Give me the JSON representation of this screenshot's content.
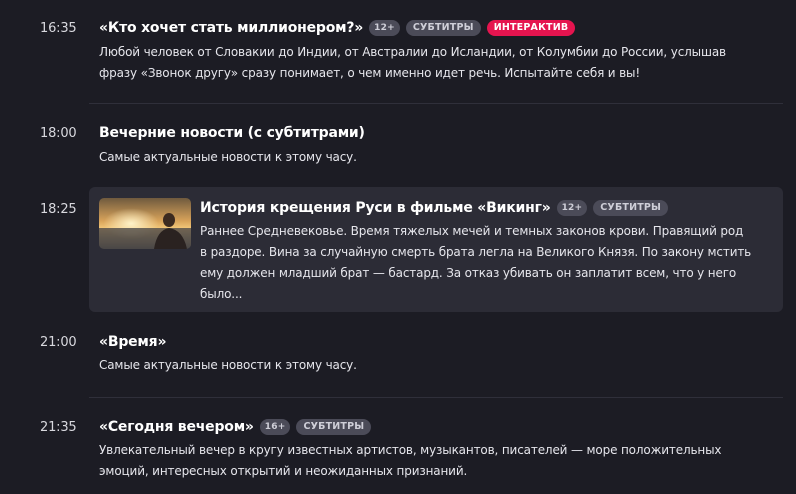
{
  "programs": [
    {
      "time": "16:35",
      "title": "«Кто хочет стать миллионером?»",
      "age": "12+",
      "badges": [
        "СУБТИТРЫ",
        "ИНТЕРАКТИВ"
      ],
      "description_lines": [
        "Любой человек от Словакии до Индии, от Австралии до Исландии, от Колумбии до России, услышав",
        "фразу «Звонок другу» сразу понимает, о чем именно идет речь. Испытайте себя и вы!"
      ]
    },
    {
      "time": "18:00",
      "title": "Вечерние новости (с субтитрами)",
      "description_lines": [
        "Самые актуальные новости к этому часу."
      ]
    },
    {
      "time": "18:25",
      "title": "История крещения Руси в фильме «Викинг»",
      "age": "12+",
      "badges": [
        "СУБТИТРЫ"
      ],
      "thumbnail": "sunset-warrior-still",
      "description_lines": [
        "Раннее Средневековье. Время тяжелых мечей и темных законов крови. Правящий род",
        "в раздоре. Вина за случайную смерть брата легла на Великого Князя. По закону мстить",
        "ему должен младший брат — бастард. За отказ убивать он заплатит всем, что у него",
        "было..."
      ]
    },
    {
      "time": "21:00",
      "title": "«Время»",
      "description_lines": [
        "Самые актуальные новости к этому часу."
      ]
    },
    {
      "time": "21:35",
      "title": "«Сегодня вечером»",
      "age": "16+",
      "badges": [
        "СУБТИТРЫ"
      ],
      "description_lines": [
        "Увлекательный вечер в кругу известных артистов, музыкантов, писателей — море положительных",
        "эмоций, интересных открытий и неожиданных признаний."
      ]
    }
  ],
  "colors": {
    "background": "#1c1c24",
    "card": "#2c2c36",
    "badge": "#4b4b58",
    "interactive": "#e5144f"
  }
}
